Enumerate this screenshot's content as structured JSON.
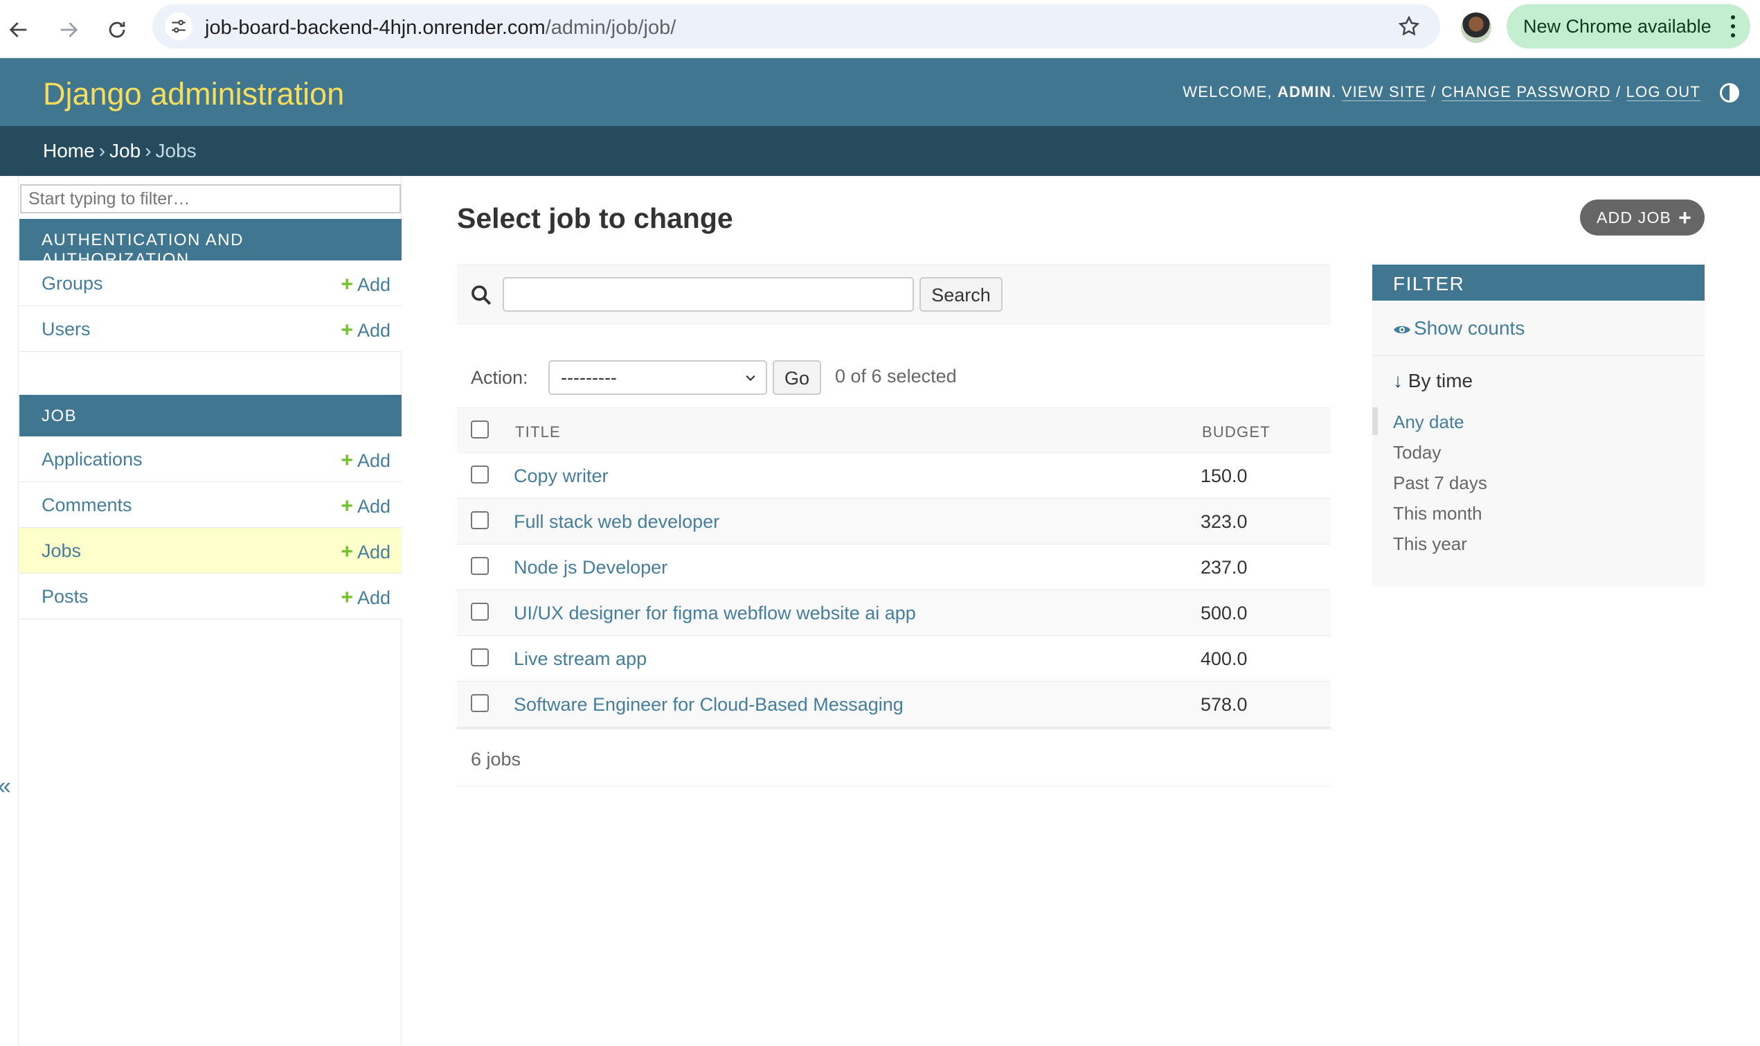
{
  "browser": {
    "url_host": "job-board-backend-4hjn.onrender.com",
    "url_path": "/admin/job/job/",
    "update_label": "New Chrome available"
  },
  "header": {
    "branding": "Django administration",
    "welcome": "Welcome,",
    "user": "admin",
    "view_site": "View site",
    "change_password": "Change password",
    "log_out": "Log out"
  },
  "breadcrumbs": {
    "home": "Home",
    "app": "Job",
    "model": "Jobs"
  },
  "sidebar": {
    "filter_placeholder": "Start typing to filter…",
    "add_label": "Add",
    "modules": [
      {
        "caption": "Authentication and Authorization",
        "models": [
          "Groups",
          "Users"
        ]
      },
      {
        "caption": "Job",
        "models": [
          "Applications",
          "Comments",
          "Jobs",
          "Posts"
        ]
      }
    ],
    "collapse": "«"
  },
  "content": {
    "title": "Select job to change",
    "add_button": "Add Job",
    "search_button": "Search",
    "action_label": "Action:",
    "action_selected": "---------",
    "go_button": "Go",
    "selection_counter": "0 of 6 selected",
    "columns": {
      "title": "Title",
      "budget": "Budget"
    },
    "rows": [
      {
        "title": "Copy writer",
        "budget": "150.0"
      },
      {
        "title": "Full stack web developer",
        "budget": "323.0"
      },
      {
        "title": "Node js Developer",
        "budget": "237.0"
      },
      {
        "title": "UI/UX designer for figma webflow website ai app",
        "budget": "500.0"
      },
      {
        "title": "Live stream app",
        "budget": "400.0"
      },
      {
        "title": "Software Engineer for Cloud-Based Messaging",
        "budget": "578.0"
      }
    ],
    "result_count": "6 jobs"
  },
  "filter": {
    "title": "Filter",
    "show_counts": "Show counts",
    "group_title": "By time",
    "choices": [
      "Any date",
      "Today",
      "Past 7 days",
      "This month",
      "This year"
    ],
    "selected": "Any date"
  },
  "colors": {
    "header": "#417690",
    "breadcrumbs": "#264b5d",
    "branding": "#f5dd5d",
    "link": "#447e9b",
    "add_green": "#70bf2b",
    "current_row": "#ffffcc"
  }
}
